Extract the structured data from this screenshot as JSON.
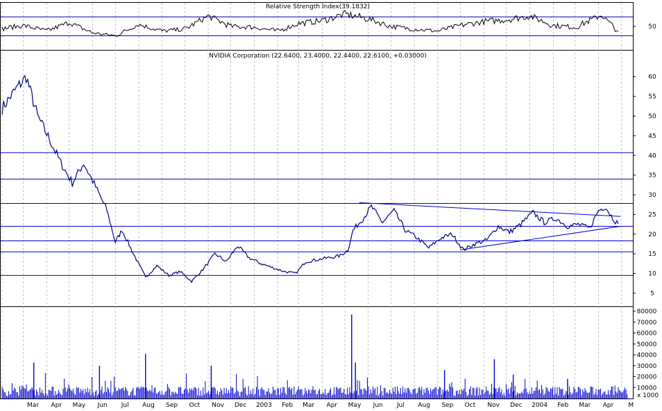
{
  "colors": {
    "background": "#ffffff",
    "line": "#000000",
    "hline": "#0000cc",
    "volume": "#0000cc",
    "grid": "#999999"
  },
  "rsi_panel": {
    "title": "Relative Strength Index(39.1832)",
    "yticks": [
      "50"
    ],
    "ylim": [
      0,
      100
    ],
    "upper_level": 70,
    "lower_level": 30
  },
  "price_panel": {
    "title": "NVIDIA Corporation (22.6400, 23.4000, 22.4400, 22.6100, +0.03000)",
    "yticks": [
      "5",
      "10",
      "15",
      "20",
      "25",
      "30",
      "35",
      "40",
      "45",
      "50",
      "55",
      "60"
    ],
    "ylim": [
      2,
      64
    ],
    "horizontal_lines": [
      40.7,
      34.0,
      27.8,
      22.0,
      18.3,
      15.5,
      9.5
    ]
  },
  "volume_panel": {
    "yticks": [
      "10000",
      "20000",
      "30000",
      "40000",
      "50000",
      "60000",
      "70000",
      "80000"
    ],
    "ylim": [
      0,
      80000
    ],
    "unit_label": "x 1000"
  },
  "xaxis": {
    "labels": [
      "Mar",
      "Apr",
      "May",
      "Jun",
      "Jul",
      "Aug",
      "Sep",
      "Oct",
      "Nov",
      "Dec",
      "2003",
      "Feb",
      "Mar",
      "Apr",
      "May",
      "Jun",
      "Jul",
      "Aug",
      "Sep",
      "Oct",
      "Nov",
      "Dec",
      "2004",
      "Feb",
      "Mar",
      "Apr",
      "M"
    ],
    "first_tick": "Feb 2002",
    "last_tick": "May 2004"
  },
  "chart_data": {
    "type": "line",
    "x_unit": "month",
    "price_keypoints": [
      {
        "x": "2002-02-01",
        "y": 52
      },
      {
        "x": "2002-02-20",
        "y": 57
      },
      {
        "x": "2002-03-05",
        "y": 60
      },
      {
        "x": "2002-03-20",
        "y": 50
      },
      {
        "x": "2002-04-05",
        "y": 44
      },
      {
        "x": "2002-04-20",
        "y": 38
      },
      {
        "x": "2002-05-05",
        "y": 33
      },
      {
        "x": "2002-05-20",
        "y": 38
      },
      {
        "x": "2002-06-05",
        "y": 32
      },
      {
        "x": "2002-06-20",
        "y": 26
      },
      {
        "x": "2002-07-01",
        "y": 18
      },
      {
        "x": "2002-07-10",
        "y": 21
      },
      {
        "x": "2002-07-25",
        "y": 15
      },
      {
        "x": "2002-08-10",
        "y": 9
      },
      {
        "x": "2002-08-25",
        "y": 12
      },
      {
        "x": "2002-09-10",
        "y": 9.5
      },
      {
        "x": "2002-09-25",
        "y": 10.5
      },
      {
        "x": "2002-10-10",
        "y": 8
      },
      {
        "x": "2002-10-25",
        "y": 11
      },
      {
        "x": "2002-11-10",
        "y": 15
      },
      {
        "x": "2002-11-25",
        "y": 13
      },
      {
        "x": "2002-12-10",
        "y": 17
      },
      {
        "x": "2002-12-25",
        "y": 14
      },
      {
        "x": "2003-01-10",
        "y": 12.5
      },
      {
        "x": "2003-01-25",
        "y": 11.5
      },
      {
        "x": "2003-02-10",
        "y": 10.5
      },
      {
        "x": "2003-02-25",
        "y": 10
      },
      {
        "x": "2003-03-10",
        "y": 13
      },
      {
        "x": "2003-03-25",
        "y": 13.5
      },
      {
        "x": "2003-04-10",
        "y": 14
      },
      {
        "x": "2003-04-25",
        "y": 14.5
      },
      {
        "x": "2003-05-05",
        "y": 16
      },
      {
        "x": "2003-05-12",
        "y": 21
      },
      {
        "x": "2003-05-25",
        "y": 24
      },
      {
        "x": "2003-06-05",
        "y": 27
      },
      {
        "x": "2003-06-20",
        "y": 23
      },
      {
        "x": "2003-07-05",
        "y": 26
      },
      {
        "x": "2003-07-20",
        "y": 21
      },
      {
        "x": "2003-08-05",
        "y": 19
      },
      {
        "x": "2003-08-20",
        "y": 16.5
      },
      {
        "x": "2003-09-05",
        "y": 19
      },
      {
        "x": "2003-09-20",
        "y": 20
      },
      {
        "x": "2003-10-05",
        "y": 16
      },
      {
        "x": "2003-10-20",
        "y": 17.5
      },
      {
        "x": "2003-11-05",
        "y": 18.5
      },
      {
        "x": "2003-11-20",
        "y": 22
      },
      {
        "x": "2003-12-05",
        "y": 20.5
      },
      {
        "x": "2003-12-20",
        "y": 22.5
      },
      {
        "x": "2004-01-05",
        "y": 25.5
      },
      {
        "x": "2004-01-20",
        "y": 23
      },
      {
        "x": "2004-02-05",
        "y": 24
      },
      {
        "x": "2004-02-20",
        "y": 22
      },
      {
        "x": "2004-03-05",
        "y": 22.5
      },
      {
        "x": "2004-03-20",
        "y": 21.5
      },
      {
        "x": "2004-04-01",
        "y": 26
      },
      {
        "x": "2004-04-10",
        "y": 27
      },
      {
        "x": "2004-04-20",
        "y": 24
      },
      {
        "x": "2004-04-27",
        "y": 22.61
      }
    ],
    "trendlines": [
      {
        "from": {
          "x": "2003-05-20",
          "y": 28.0
        },
        "to": {
          "x": "2004-04-30",
          "y": 24.5
        }
      },
      {
        "from": {
          "x": "2003-10-01",
          "y": 16.0
        },
        "to": {
          "x": "2004-04-30",
          "y": 22.0
        }
      }
    ],
    "rsi_keypoints": [
      {
        "x": "2002-02-01",
        "y": 45
      },
      {
        "x": "2002-03-01",
        "y": 52
      },
      {
        "x": "2002-04-01",
        "y": 40
      },
      {
        "x": "2002-05-01",
        "y": 58
      },
      {
        "x": "2002-06-01",
        "y": 36
      },
      {
        "x": "2002-07-01",
        "y": 30
      },
      {
        "x": "2002-08-01",
        "y": 54
      },
      {
        "x": "2002-09-01",
        "y": 40
      },
      {
        "x": "2002-10-01",
        "y": 44
      },
      {
        "x": "2002-11-01",
        "y": 72
      },
      {
        "x": "2002-12-01",
        "y": 50
      },
      {
        "x": "2003-01-01",
        "y": 48
      },
      {
        "x": "2003-02-01",
        "y": 40
      },
      {
        "x": "2003-03-01",
        "y": 56
      },
      {
        "x": "2003-04-01",
        "y": 62
      },
      {
        "x": "2003-05-01",
        "y": 76
      },
      {
        "x": "2003-06-01",
        "y": 66
      },
      {
        "x": "2003-07-01",
        "y": 50
      },
      {
        "x": "2003-08-01",
        "y": 44
      },
      {
        "x": "2003-09-01",
        "y": 40
      },
      {
        "x": "2003-10-01",
        "y": 52
      },
      {
        "x": "2003-11-01",
        "y": 60
      },
      {
        "x": "2003-12-01",
        "y": 64
      },
      {
        "x": "2004-01-01",
        "y": 72
      },
      {
        "x": "2004-02-01",
        "y": 52
      },
      {
        "x": "2004-03-01",
        "y": 48
      },
      {
        "x": "2004-04-05",
        "y": 74
      },
      {
        "x": "2004-04-27",
        "y": 39.18
      }
    ],
    "volume_spikes": [
      {
        "x": "2002-03-15",
        "y": 33000
      },
      {
        "x": "2002-06-10",
        "y": 30000
      },
      {
        "x": "2002-08-10",
        "y": 41000
      },
      {
        "x": "2002-11-05",
        "y": 30000
      },
      {
        "x": "2003-05-10",
        "y": 77000
      },
      {
        "x": "2003-05-15",
        "y": 33000
      },
      {
        "x": "2003-09-10",
        "y": 26000
      },
      {
        "x": "2003-11-15",
        "y": 36000
      },
      {
        "x": "2003-12-10",
        "y": 22000
      },
      {
        "x": "2004-02-20",
        "y": 18000
      }
    ],
    "volume_baseline": 8000
  }
}
